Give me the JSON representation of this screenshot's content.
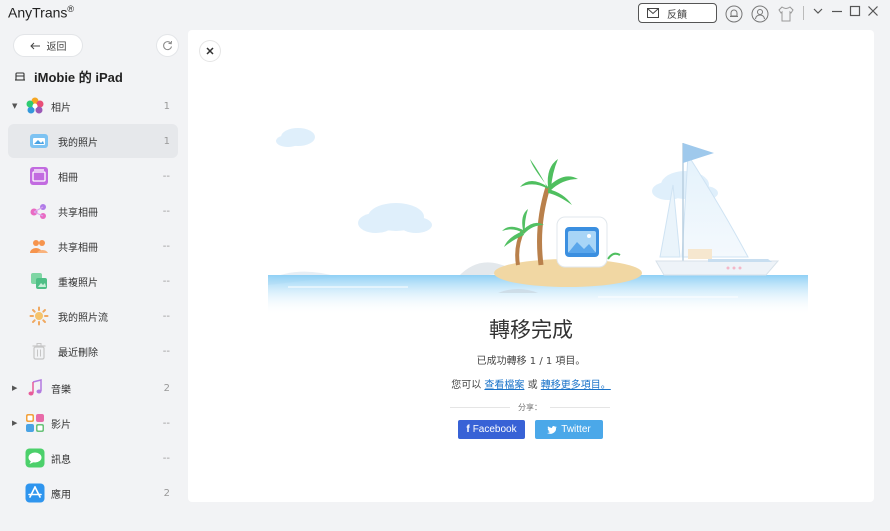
{
  "window": {
    "app_title": "AnyTrans",
    "app_title_mark": "®",
    "feedback_label": "反饋"
  },
  "sidebar": {
    "back_label": "返回",
    "device_name": "iMobie 的 iPad",
    "items": [
      {
        "label": "相片",
        "count": "1"
      },
      {
        "label": "我的照片",
        "count": "1"
      },
      {
        "label": "相冊",
        "count": "--"
      },
      {
        "label": "共享相冊",
        "count": "--"
      },
      {
        "label": "共享相冊",
        "count": "--"
      },
      {
        "label": "重複照片",
        "count": "--"
      },
      {
        "label": "我的照片流",
        "count": "--"
      },
      {
        "label": "最近刪除",
        "count": "--"
      },
      {
        "label": "音樂",
        "count": "2"
      },
      {
        "label": "影片",
        "count": "--"
      },
      {
        "label": "訊息",
        "count": "--"
      },
      {
        "label": "應用",
        "count": "2"
      }
    ]
  },
  "main": {
    "title": "轉移完成",
    "message": "已成功轉移 1 / 1 項目。",
    "links_prefix": "您可以",
    "link_view": "查看檔案",
    "links_or": "或",
    "link_more": "轉移更多項目。",
    "share_label": "分享：",
    "facebook_label": "Facebook",
    "twitter_label": "Twitter"
  },
  "colors": {
    "accent_blue": "#1a73c9",
    "facebook": "#3862d6",
    "twitter": "#4ba8e9",
    "selected_bg": "#e6e8eb"
  }
}
